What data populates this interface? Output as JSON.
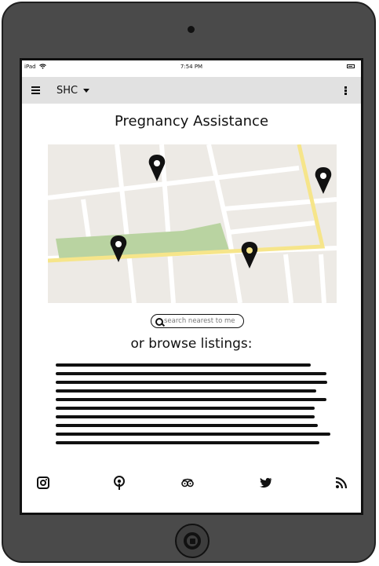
{
  "status_bar": {
    "device_label": "iPad",
    "time": "7:54 PM"
  },
  "app_bar": {
    "title": "SHC"
  },
  "page": {
    "title": "Pregnancy Assistance",
    "search_placeholder": "search nearest to me",
    "browse_heading": "or browse listings:"
  },
  "icons": {
    "status": [
      "wifi-icon",
      "battery-icon"
    ],
    "app_bar": [
      "menu-icon",
      "chevron-down-icon",
      "more-vertical-icon"
    ],
    "bottom": [
      "instagram-icon",
      "podcast-icon",
      "tripadvisor-icon",
      "twitter-icon",
      "rss-icon"
    ]
  },
  "colors": {
    "device_frame": "#4a4a4a",
    "app_bar": "#e1e1e1",
    "map_background": "#edeae5",
    "map_road": "#ffffff",
    "map_highlight_road": "#f6e58a",
    "map_park": "#b9d3a1",
    "map_pin": "#111111"
  }
}
